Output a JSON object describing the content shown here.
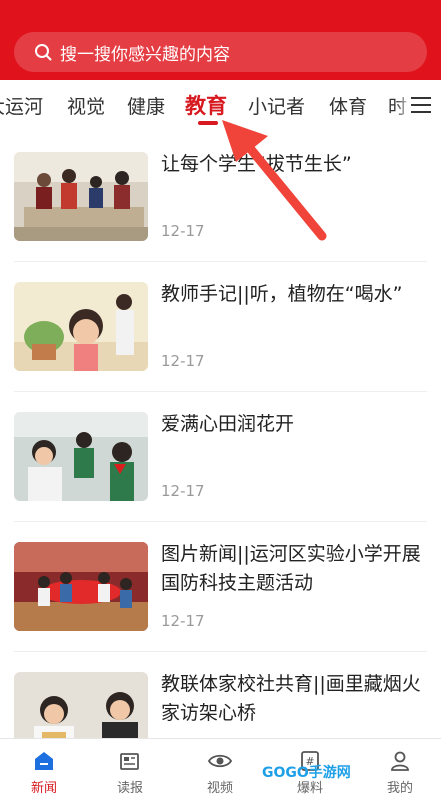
{
  "search": {
    "placeholder": "搜一搜你感兴趣的内容"
  },
  "tabs": [
    "大运河",
    "视觉",
    "健康",
    "教育",
    "小记者",
    "体育",
    "时"
  ],
  "active_tab": "教育",
  "articles": [
    {
      "title": "让每个学生“拔节生长”",
      "date": "12-17"
    },
    {
      "title": "教师手记||听，植物在“喝水”",
      "date": "12-17"
    },
    {
      "title": "爱满心田润花开",
      "date": "12-17"
    },
    {
      "title": "图片新闻||运河区实验小学开展国防科技主题活动",
      "date": "12-17"
    },
    {
      "title": "教联体家校社共育||画里藏烟火 家访架心桥",
      "date": ""
    }
  ],
  "bottom_nav": [
    {
      "label": "新闻",
      "icon": "news-home-icon"
    },
    {
      "label": "读报",
      "icon": "newspaper-icon"
    },
    {
      "label": "视频",
      "icon": "eye-icon"
    },
    {
      "label": "爆料",
      "icon": "hash-icon"
    },
    {
      "label": "我的",
      "icon": "user-icon"
    }
  ],
  "watermark": "GOGO手游网",
  "colors": {
    "brand_red": "#e0131c",
    "active_red": "#d71920"
  }
}
